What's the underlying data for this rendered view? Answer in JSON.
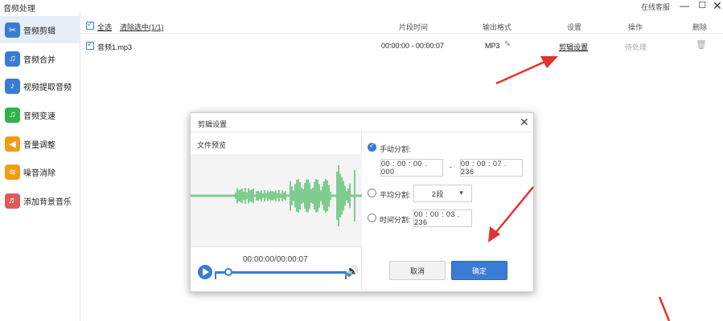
{
  "window": {
    "title": "音频处理",
    "online_service": "在线客服",
    "min_glyph": "—",
    "max_glyph": "☐",
    "close_glyph": "✕"
  },
  "sidebar": {
    "items": [
      {
        "label": "音频剪辑",
        "icon": "scissors-music-icon",
        "color": "#3a7bd5",
        "glyph": "✂",
        "active": true
      },
      {
        "label": "音频合并",
        "icon": "music-merge-icon",
        "color": "#3a7bd5",
        "glyph": "♫"
      },
      {
        "label": "视频提取音频",
        "icon": "video-extract-icon",
        "color": "#3a7bd5",
        "glyph": "♪"
      },
      {
        "label": "音频变速",
        "icon": "speed-icon",
        "color": "#2fb34a",
        "glyph": "♫"
      },
      {
        "label": "音量调整",
        "icon": "volume-icon",
        "color": "#f39c12",
        "glyph": "◀"
      },
      {
        "label": "噪音消除",
        "icon": "noise-icon",
        "color": "#f39c12",
        "glyph": "≋"
      },
      {
        "label": "添加背景音乐",
        "icon": "bg-music-icon",
        "color": "#e05a5a",
        "glyph": "♬"
      }
    ]
  },
  "list": {
    "select_all": "全选",
    "clear_selected": "清除选中(1/1)",
    "headers": {
      "segment_time": "片段时间",
      "output_format": "输出格式",
      "settings": "设置",
      "action": "操作",
      "delete": "删除"
    },
    "rows": [
      {
        "filename": "音频1.mp3",
        "segment": "00:00:00 - 00:00:07",
        "format": "MP3",
        "settings_link": "剪辑设置",
        "status": "待处理"
      }
    ]
  },
  "dialog": {
    "title": "剪辑设置",
    "close_glyph": "✕",
    "preview_label": "文件预览",
    "time_readout": "00:00:00/00:00:07",
    "playback_progress": 0.1,
    "manual_split": {
      "label": "手动分割:",
      "start": "00 : 00 : 00 . 000",
      "separator": "-",
      "end": "00 : 00 : 07 . 236"
    },
    "average_split": {
      "label": "平均分割:",
      "value": "2段"
    },
    "time_split": {
      "label": "时间分割:",
      "value": "00 : 00 : 03 . 236"
    },
    "cancel": "取消",
    "ok": "确定"
  },
  "colors": {
    "accent": "#3a7bd5",
    "waveform": "#2fb34a",
    "annotation_arrow": "#e5322d"
  }
}
